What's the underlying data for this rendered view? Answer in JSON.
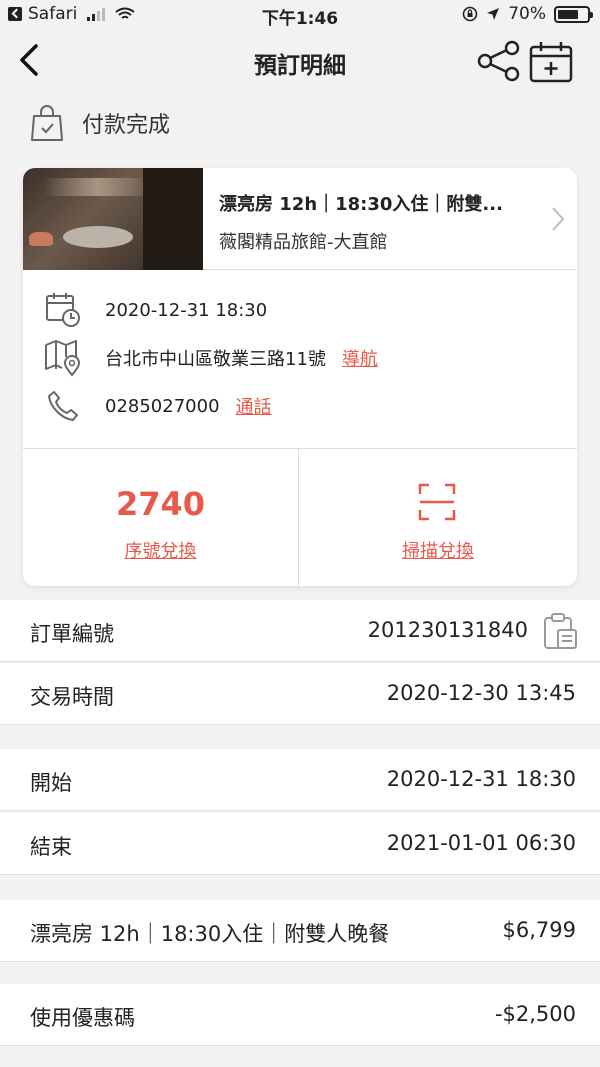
{
  "status_bar": {
    "app": "Safari",
    "time": "下午1:46",
    "battery": "70%",
    "battery_level": 0.7
  },
  "nav": {
    "title": "預訂明細"
  },
  "payment": {
    "status": "付款完成"
  },
  "booking": {
    "room_name": "漂亮房 12h｜18:30入住｜附雙...",
    "hotel_name": "薇閣精品旅館-大直館",
    "date": "2020-12-31 18:30",
    "address": "台北市中山區敬業三路11號",
    "navigate_label": "導航",
    "phone": "0285027000",
    "call_label": "通話",
    "code": "2740",
    "code_redeem_label": "序號兌換",
    "scan_redeem_label": "掃描兌換"
  },
  "details": {
    "order_no_label": "訂單編號",
    "order_no": "201230131840",
    "trade_time_label": "交易時間",
    "trade_time": "2020-12-30 13:45",
    "start_label": "開始",
    "start": "2020-12-31 18:30",
    "end_label": "結束",
    "end": "2021-01-01 06:30",
    "item_label": "漂亮房 12h｜18:30入住｜附雙人晚餐",
    "item_price": "$6,799",
    "coupon_label": "使用優惠碼",
    "coupon_value": "-$2,500"
  },
  "colors": {
    "accent": "#e8594a"
  }
}
